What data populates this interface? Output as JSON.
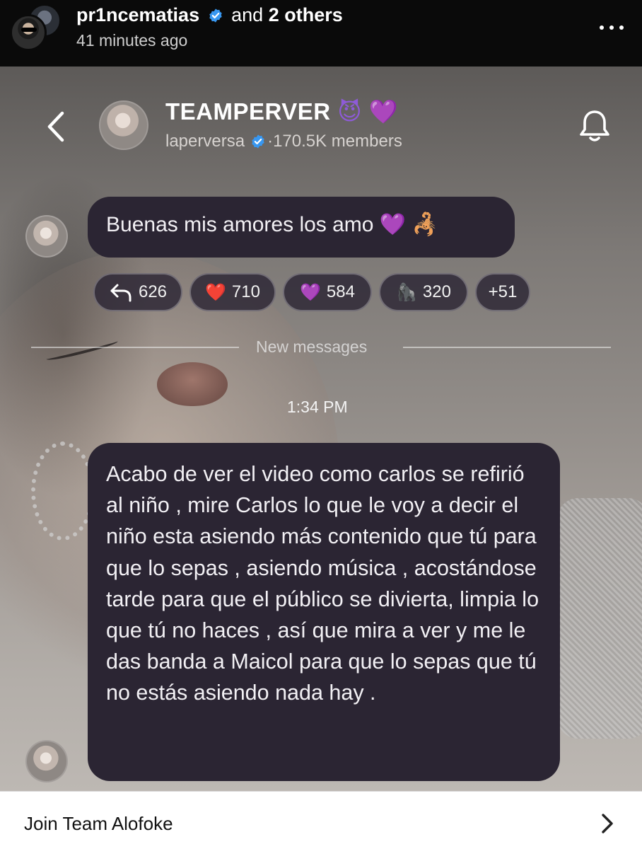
{
  "post": {
    "username": "pr1ncematias",
    "and_text": "and",
    "others": "2 others",
    "time": "41 minutes ago"
  },
  "channel": {
    "name": "TEAMPERVER",
    "name_emojis": [
      "😈",
      "💜"
    ],
    "owner": "laperversa",
    "members": "170.5K members"
  },
  "messages": [
    {
      "text": "Buenas mis amores los amo 💜 🦂"
    },
    {
      "text": "Acabo de ver el video como carlos se refirió al niño , mire Carlos lo que le voy a decir el niño esta asiendo más contenido que tú para que lo sepas , asiendo música , acostándose tarde para que el público se divierta, limpia lo que tú no haces , así que mira a ver y me le das banda a Maicol para que lo sepas que tú no estás asiendo nada hay ."
    }
  ],
  "reactions": [
    {
      "icon": "reply-icon",
      "count": "626"
    },
    {
      "icon": "❤️",
      "count": "710"
    },
    {
      "icon": "💜",
      "count": "584"
    },
    {
      "icon": "🦍",
      "count": "320"
    },
    {
      "icon": "",
      "count": "+51"
    }
  ],
  "divider": {
    "label": "New messages"
  },
  "timestamp": "1:34 PM",
  "footer": {
    "label": "Join Team Alofoke"
  },
  "colors": {
    "bubble": "#2b2533",
    "verified": "#3897f0",
    "heart_purple": "#9b4ef0",
    "heart_red": "#e0323a"
  }
}
